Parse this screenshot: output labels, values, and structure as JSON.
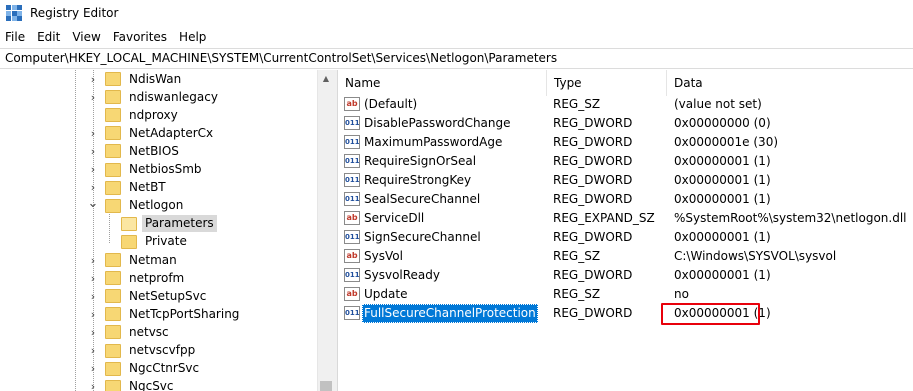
{
  "window": {
    "title": "Registry Editor",
    "icon": "registry-editor-icon"
  },
  "menu": {
    "items": [
      "File",
      "Edit",
      "View",
      "Favorites",
      "Help"
    ]
  },
  "address": {
    "path": "Computer\\HKEY_LOCAL_MACHINE\\SYSTEM\\CurrentControlSet\\Services\\Netlogon\\Parameters"
  },
  "tree": {
    "items": [
      {
        "label": "NdisWan",
        "expander": "›",
        "open": false
      },
      {
        "label": "ndiswanlegacy",
        "expander": "›",
        "open": false
      },
      {
        "label": "ndproxy",
        "expander": "",
        "open": false
      },
      {
        "label": "NetAdapterCx",
        "expander": "›",
        "open": false
      },
      {
        "label": "NetBIOS",
        "expander": "›",
        "open": false
      },
      {
        "label": "NetbiosSmb",
        "expander": "›",
        "open": false
      },
      {
        "label": "NetBT",
        "expander": "›",
        "open": false
      },
      {
        "label": "Netlogon",
        "expander": "⌄",
        "open": false
      },
      {
        "label": "Parameters",
        "expander": "",
        "open": true,
        "selected": true
      },
      {
        "label": "Private",
        "expander": "",
        "open": false
      },
      {
        "label": "Netman",
        "expander": "›",
        "open": false
      },
      {
        "label": "netprofm",
        "expander": "›",
        "open": false
      },
      {
        "label": "NetSetupSvc",
        "expander": "›",
        "open": false
      },
      {
        "label": "NetTcpPortSharing",
        "expander": "›",
        "open": false
      },
      {
        "label": "netvsc",
        "expander": "›",
        "open": false
      },
      {
        "label": "netvscvfpp",
        "expander": "›",
        "open": false
      },
      {
        "label": "NgcCtnrSvc",
        "expander": "›",
        "open": false
      },
      {
        "label": "NgcSvc",
        "expander": "›",
        "open": false
      }
    ]
  },
  "values": {
    "columns": {
      "name": "Name",
      "type": "Type",
      "data": "Data"
    },
    "rows": [
      {
        "icon": "ab",
        "kind": "sz",
        "name": "(Default)",
        "type": "REG_SZ",
        "data": "(value not set)"
      },
      {
        "icon": "011",
        "kind": "dw",
        "name": "DisablePasswordChange",
        "type": "REG_DWORD",
        "data": "0x00000000 (0)"
      },
      {
        "icon": "011",
        "kind": "dw",
        "name": "MaximumPasswordAge",
        "type": "REG_DWORD",
        "data": "0x0000001e (30)"
      },
      {
        "icon": "011",
        "kind": "dw",
        "name": "RequireSignOrSeal",
        "type": "REG_DWORD",
        "data": "0x00000001 (1)"
      },
      {
        "icon": "011",
        "kind": "dw",
        "name": "RequireStrongKey",
        "type": "REG_DWORD",
        "data": "0x00000001 (1)"
      },
      {
        "icon": "011",
        "kind": "dw",
        "name": "SealSecureChannel",
        "type": "REG_DWORD",
        "data": "0x00000001 (1)"
      },
      {
        "icon": "ab",
        "kind": "sz",
        "name": "ServiceDll",
        "type": "REG_EXPAND_SZ",
        "data": "%SystemRoot%\\system32\\netlogon.dll"
      },
      {
        "icon": "011",
        "kind": "dw",
        "name": "SignSecureChannel",
        "type": "REG_DWORD",
        "data": "0x00000001 (1)"
      },
      {
        "icon": "ab",
        "kind": "sz",
        "name": "SysVol",
        "type": "REG_SZ",
        "data": "C:\\Windows\\SYSVOL\\sysvol"
      },
      {
        "icon": "011",
        "kind": "dw",
        "name": "SysvolReady",
        "type": "REG_DWORD",
        "data": "0x00000001 (1)"
      },
      {
        "icon": "ab",
        "kind": "sz",
        "name": "Update",
        "type": "REG_SZ",
        "data": "no"
      },
      {
        "icon": "011",
        "kind": "dw",
        "name": "FullSecureChannelProtection",
        "type": "REG_DWORD",
        "data": "0x00000001 (1)",
        "selected": true
      }
    ]
  },
  "colors": {
    "selection": "#0078d7",
    "highlight_box": "#e8000b",
    "folder": "#f7d774"
  }
}
